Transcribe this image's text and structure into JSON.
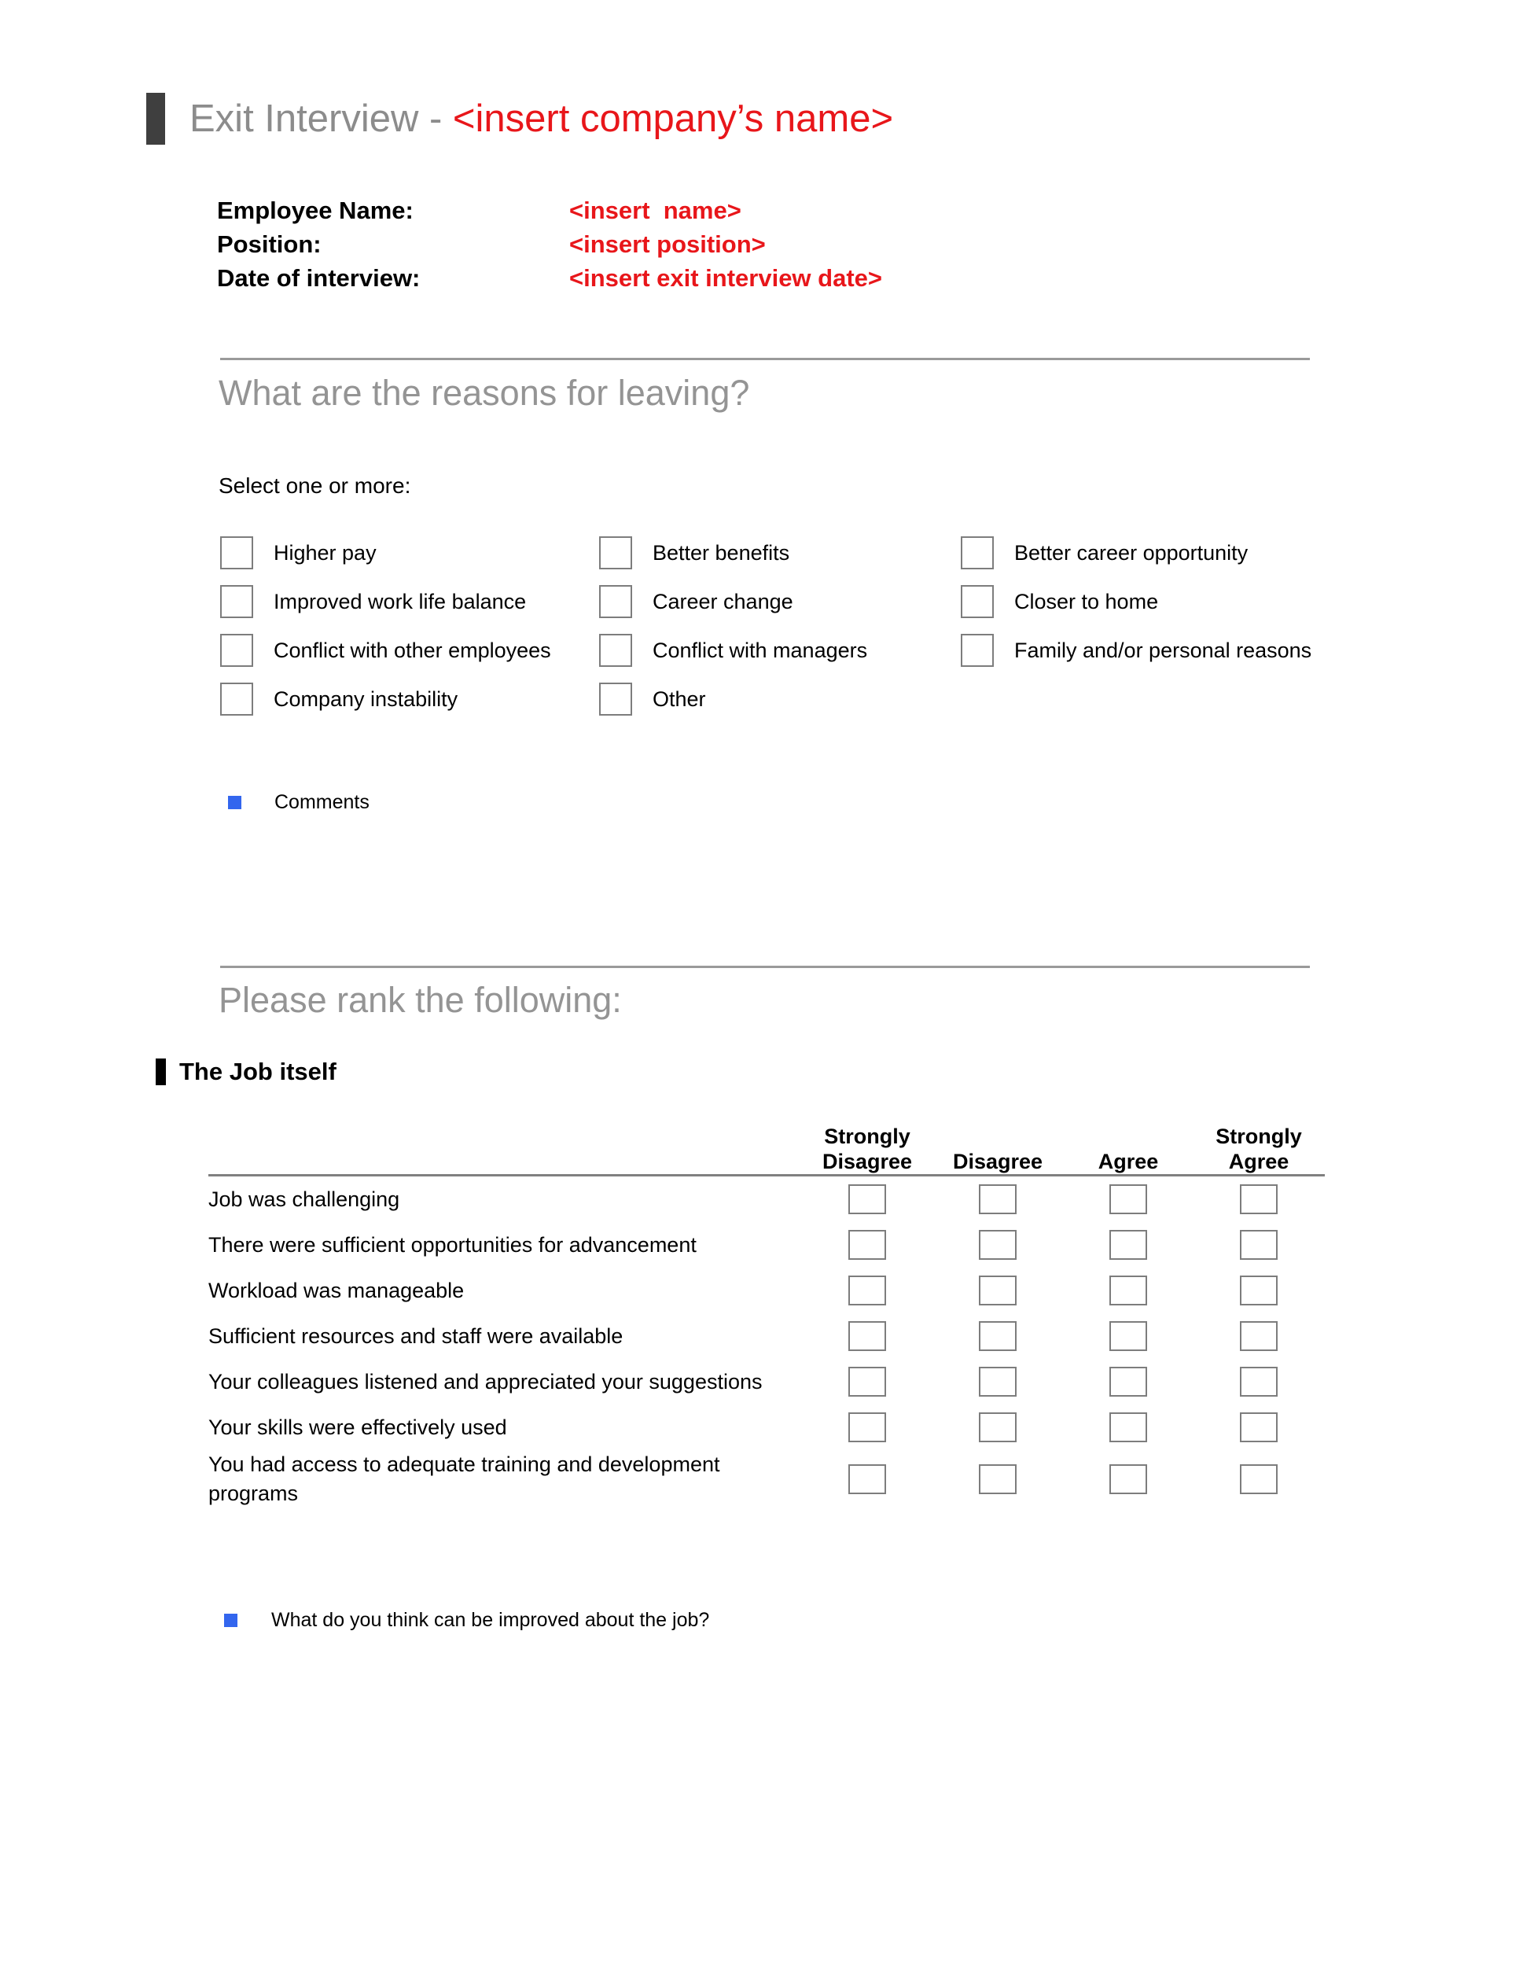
{
  "document": {
    "title_prefix": "Exit Interview - ",
    "title_company_placeholder": "<insert company’s name>",
    "accent_red": "#e8161a",
    "accent_gray": "#949494",
    "bullet_blue": "#3366ee",
    "marker_dark": "#3f3f3f"
  },
  "employee": {
    "name_label": "Employee Name:",
    "name_value": "<insert  name>",
    "position_label": "Position:",
    "position_value": "<insert position>",
    "date_label": "Date of interview:",
    "date_value": "<insert exit interview date>"
  },
  "reasons_section": {
    "heading": "What are the reasons for leaving?",
    "instruction": "Select one or more:",
    "options_grid": [
      [
        "Higher pay",
        "Better benefits",
        "Better career opportunity"
      ],
      [
        "Improved work life balance",
        "Career change",
        "Closer to home"
      ],
      [
        "Conflict with other employees",
        "Conflict with managers",
        "Family and/or personal reasons"
      ],
      [
        "Company instability",
        "Other",
        ""
      ]
    ],
    "comments_bullet": "Comments"
  },
  "rank_section": {
    "heading": "Please rank the following:",
    "subsection_title": "The Job itself",
    "columns": [
      "Strongly Disagree",
      "Disagree",
      "Agree",
      "Strongly Agree"
    ],
    "column_lines": [
      [
        "Strongly",
        "Disagree"
      ],
      [
        "Disagree",
        ""
      ],
      [
        "Agree",
        ""
      ],
      [
        "Strongly",
        "Agree"
      ]
    ],
    "rows": [
      "Job was challenging",
      "There were sufficient opportunities for advancement",
      "Workload was manageable",
      "Sufficient resources and staff were available",
      "Your colleagues listened and appreciated your suggestions",
      "Your skills were effectively used",
      "You had access to adequate training and development programs"
    ],
    "followup_bullet": "What do you think can be improved about the job?"
  }
}
